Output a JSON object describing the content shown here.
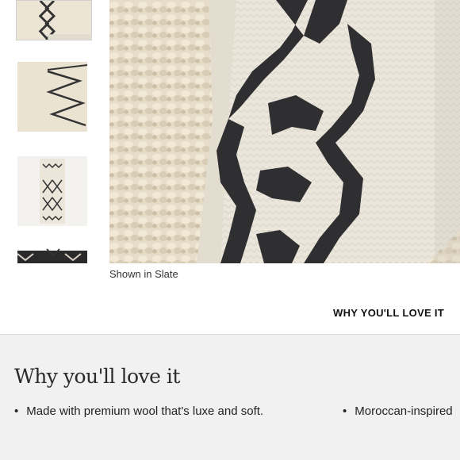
{
  "gallery": {
    "caption": "Shown in Slate",
    "thumbnails": [
      "rug-detail-thumbnail",
      "zigzag-texture-thumbnail",
      "full-rug-thumbnail",
      "dark-rug-thumbnail"
    ],
    "scroll_icon": "chevron-down-icon",
    "colors": {
      "cream": "#ece5d6",
      "charcoal": "#2f2f31"
    }
  },
  "nav": {
    "why_link": "WHY YOU'LL LOVE IT"
  },
  "why_section": {
    "title": "Why you'll love it",
    "bullets": [
      "Made with premium wool that's luxe and soft.",
      "Moroccan-inspired"
    ],
    "background": "#f1f1f2"
  }
}
